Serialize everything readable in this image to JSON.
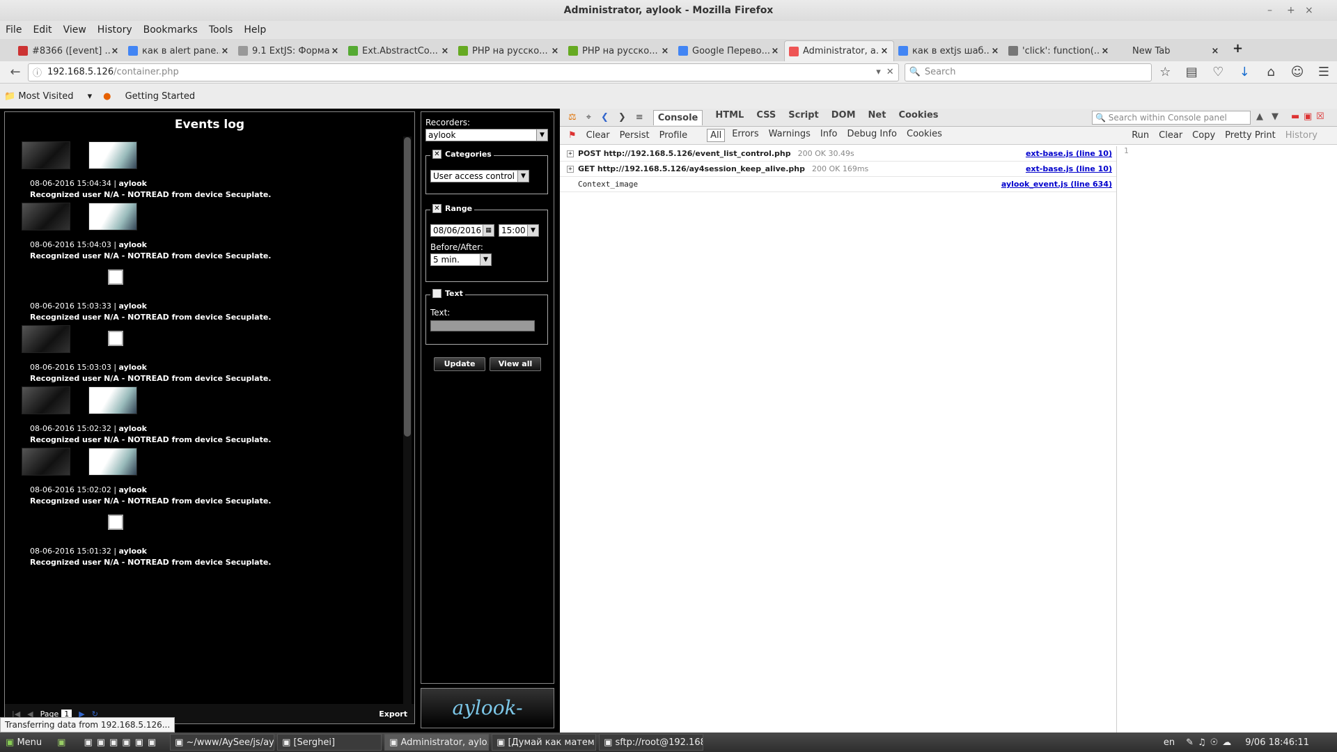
{
  "window": {
    "title": "Administrator, aylook - Mozilla Firefox"
  },
  "menu": [
    "File",
    "Edit",
    "View",
    "History",
    "Bookmarks",
    "Tools",
    "Help"
  ],
  "tabs": [
    {
      "label": "#8366 ([event] ...",
      "icon": "redmine-icon",
      "color": "#c33"
    },
    {
      "label": "как в alert pane...",
      "icon": "google-icon",
      "color": "#4285f4"
    },
    {
      "label": "9.1 ExtJS: Форма. П...",
      "icon": "page-icon",
      "color": "#999"
    },
    {
      "label": "Ext.AbstractCo...",
      "icon": "leaf-icon",
      "color": "#5a3"
    },
    {
      "label": "PHP на русско...",
      "icon": "php-icon",
      "color": "#6a2"
    },
    {
      "label": "PHP на русско...",
      "icon": "php-icon",
      "color": "#6a2"
    },
    {
      "label": "Google Перево...",
      "icon": "translate-icon",
      "color": "#4285f4"
    },
    {
      "label": "Administrator, a...",
      "icon": "loading-icon",
      "color": "#e55",
      "active": true
    },
    {
      "label": "как в extjs шаб...",
      "icon": "google-icon",
      "color": "#4285f4"
    },
    {
      "label": "'click': function(...",
      "icon": "code-icon",
      "color": "#777"
    },
    {
      "label": "New Tab",
      "icon": "",
      "color": "#999"
    }
  ],
  "nav": {
    "url_host": "192.168.5.126",
    "url_path": "/container.php",
    "search_placeholder": "Search"
  },
  "bookmarks": [
    "Most Visited",
    "Getting Started"
  ],
  "events": {
    "title": "Events log",
    "items": [
      {
        "time": "08-06-2016 15:04:34",
        "user": "aylook",
        "desc": "Recognized user N/A - NOTREAD from device Secuplate.",
        "thumbs": "both"
      },
      {
        "time": "08-06-2016 15:04:03",
        "user": "aylook",
        "desc": "Recognized user N/A - NOTREAD from device Secuplate.",
        "thumbs": "both"
      },
      {
        "time": "08-06-2016 15:03:33",
        "user": "aylook",
        "desc": "Recognized user N/A - NOTREAD from device Secuplate.",
        "thumbs": "icon"
      },
      {
        "time": "08-06-2016 15:03:03",
        "user": "aylook",
        "desc": "Recognized user N/A - NOTREAD from device Secuplate.",
        "thumbs": "dark-icon"
      },
      {
        "time": "08-06-2016 15:02:32",
        "user": "aylook",
        "desc": "Recognized user N/A - NOTREAD from device Secuplate.",
        "thumbs": "both"
      },
      {
        "time": "08-06-2016 15:02:02",
        "user": "aylook",
        "desc": "Recognized user N/A - NOTREAD from device Secuplate.",
        "thumbs": "both"
      },
      {
        "time": "08-06-2016 15:01:32",
        "user": "aylook",
        "desc": "Recognized user N/A - NOTREAD from device Secuplate.",
        "thumbs": "icon"
      }
    ],
    "footer_page_label": "Page",
    "footer_page_value": "1",
    "export_label": "Export"
  },
  "filters": {
    "recorders_label": "Recorders:",
    "recorder_value": "aylook",
    "categories_label": "Categories",
    "category_value": "User access control",
    "range_label": "Range",
    "date_value": "08/06/2016",
    "time_value": "15:00",
    "before_after_label": "Before/After:",
    "before_after_value": "5 min.",
    "text_legend": "Text",
    "text_label": "Text:",
    "update_label": "Update",
    "viewall_label": "View all"
  },
  "logo": {
    "text": "aylook-"
  },
  "firebug": {
    "tabs": [
      "Console",
      "HTML",
      "CSS",
      "Script",
      "DOM",
      "Net",
      "Cookies"
    ],
    "search_placeholder": "Search within Console panel",
    "toolbar": [
      "Clear",
      "Persist",
      "Profile"
    ],
    "filters": [
      "All",
      "Errors",
      "Warnings",
      "Info",
      "Debug Info",
      "Cookies"
    ],
    "right_actions": [
      "Run",
      "Clear",
      "Copy",
      "Pretty Print",
      "History"
    ],
    "logs": [
      {
        "method": "POST",
        "url": "http://192.168.5.126/event_list_control.php",
        "meta": "200 OK 30.49s",
        "src": "ext-base.js (line 10)"
      },
      {
        "method": "GET",
        "url": "http://192.168.5.126/ay4session_keep_alive.php",
        "meta": "200 OK 169ms",
        "src": "ext-base.js (line 10)"
      },
      {
        "method": "",
        "url": "Context_image",
        "meta": "",
        "src": "aylook_event.js (line 634)"
      }
    ],
    "cmd_line_number": "1"
  },
  "status": {
    "text": "Transferring data from 192.168.5.126..."
  },
  "taskbar": {
    "menu_label": "Menu",
    "items": [
      {
        "label": "~/www/AySee/js/ayl..."
      },
      {
        "label": "[Serghei]"
      },
      {
        "label": "Administrator, aylo...",
        "active": true
      },
      {
        "label": "[Думай как матем..."
      },
      {
        "label": "sftp://root@192.168..."
      }
    ],
    "lang": "en",
    "clock": "9/06 18:46:11"
  }
}
